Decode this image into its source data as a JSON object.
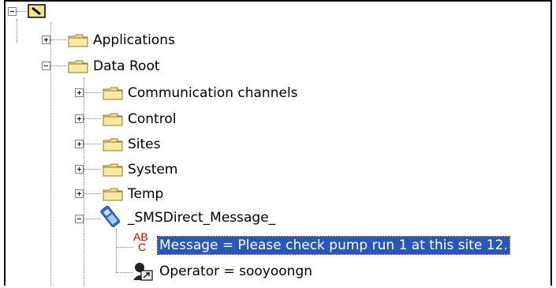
{
  "tree": {
    "root": {
      "icon": "root-node-icon",
      "expanded": true
    },
    "nodes": [
      {
        "label": "Applications",
        "icon": "folder-icon",
        "expanded": false
      },
      {
        "label": "Data Root",
        "icon": "folder-icon",
        "expanded": true,
        "children": [
          {
            "label": "Communication channels",
            "icon": "folder-icon",
            "expanded": false
          },
          {
            "label": "Control",
            "icon": "folder-icon",
            "expanded": false
          },
          {
            "label": "Sites",
            "icon": "folder-icon",
            "expanded": false
          },
          {
            "label": "System",
            "icon": "folder-icon",
            "expanded": false
          },
          {
            "label": "Temp",
            "icon": "folder-icon",
            "expanded": false
          },
          {
            "label": "_SMSDirect_Message_",
            "icon": "mobile-phone-icon",
            "expanded": true,
            "children": [
              {
                "label": "Message = Please check pump run 1 at this site 12.",
                "icon": "text-variable-icon",
                "selected": true
              },
              {
                "label": "Operator = sooyoongn",
                "icon": "operator-icon",
                "selected": false
              }
            ]
          }
        ]
      }
    ]
  },
  "colors": {
    "selection": "#2957b8",
    "folder": "#f2e48a",
    "folder_outline": "#8a7a30",
    "icon_red": "#c00000"
  }
}
